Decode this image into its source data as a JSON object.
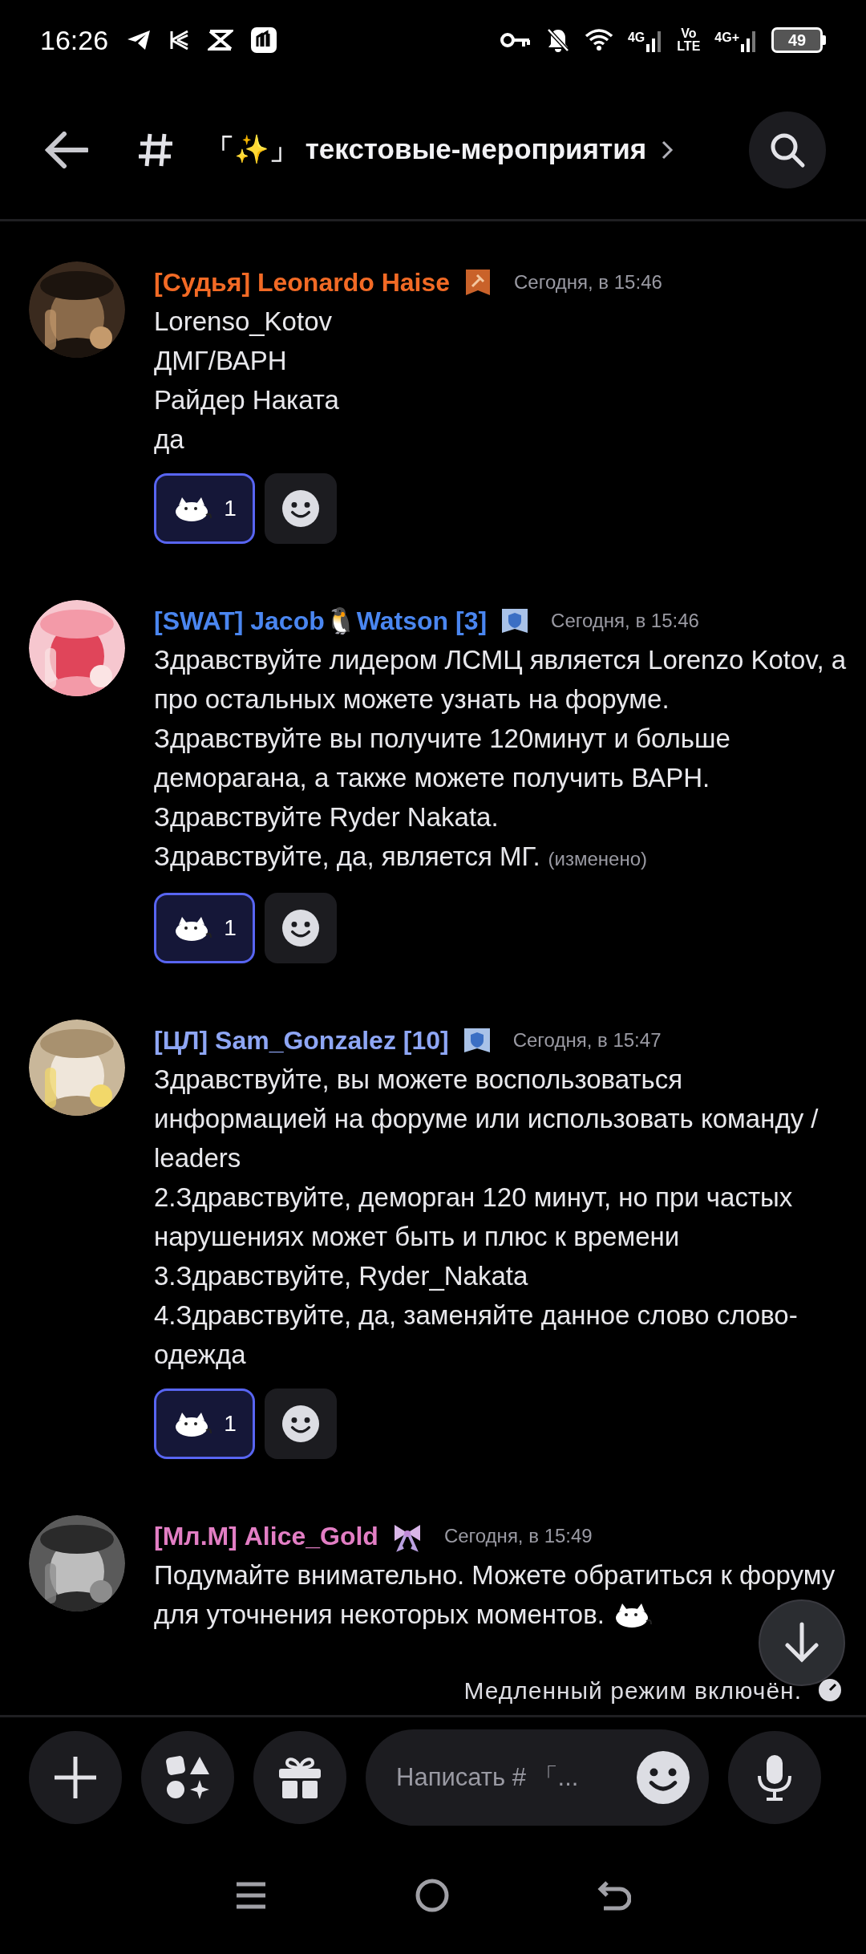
{
  "status_bar": {
    "time": "16:26",
    "net1": "4G",
    "volte_top": "Vo",
    "volte_bottom": "LTE",
    "net2": "4G+",
    "battery": "49"
  },
  "header": {
    "channel_title": "「✨」 текстовые-мероприятия"
  },
  "messages": [
    {
      "author": "[Судья] Leonardo Haise",
      "color": "#f26a25",
      "badge": {
        "kind": "gavel"
      },
      "time": "Сегодня, в 15:46",
      "paragraphs": [
        "Lorenso_Kotov",
        "ДМГ/ВАРН",
        "Райдер Наката",
        "да"
      ],
      "reaction": {
        "count": "1",
        "selected": true
      }
    },
    {
      "author": "[SWAT] Jacob🐧Watson [3]",
      "color": "#4a86f0",
      "badge": {
        "kind": "shield"
      },
      "time": "Сегодня, в 15:46",
      "paragraphs": [
        "Здравствуйте лидером ЛСМЦ является Lorenzo Kotov, а про остальных можете узнать на форуме.",
        "Здравствуйте вы получите 120минут и больше деморагана, а также можете получить ВАРН.",
        "Здравствуйте Ryder Nakata.",
        "Здравствуйте, да, является МГ."
      ],
      "edited": "(изменено)",
      "reaction": {
        "count": "1",
        "selected": true
      }
    },
    {
      "author": "[ЦЛ] Sam_Gonzalez [10]",
      "color": "#8ea6f5",
      "badge": {
        "kind": "shield"
      },
      "time": "Сегодня, в 15:47",
      "paragraphs": [
        "Здравствуйте, вы можете воспользоваться информацией на форуме или использовать команду / leaders",
        "2.Здравствуйте, деморган 120 минут, но при частых нарушениях может быть и плюс к времени",
        "3.Здравствуйте, Ryder_Nakata",
        "4.Здравствуйте, да, заменяйте данное слово слово-одежда"
      ],
      "reaction": {
        "count": "1",
        "selected": true
      }
    },
    {
      "author": "[Мл.М] Alice_Gold",
      "color": "#e27ec4",
      "badge": {
        "kind": "bow"
      },
      "time": "Сегодня, в 15:49",
      "paragraphs": [
        "Подумайте внимательно. Можете обратиться к форуму",
        "для уточнения некоторых моментов."
      ],
      "trailing_sticker": true
    }
  ],
  "slow_mode": "Медленный режим включён.",
  "composer": {
    "placeholder": "Написать # 「..."
  }
}
